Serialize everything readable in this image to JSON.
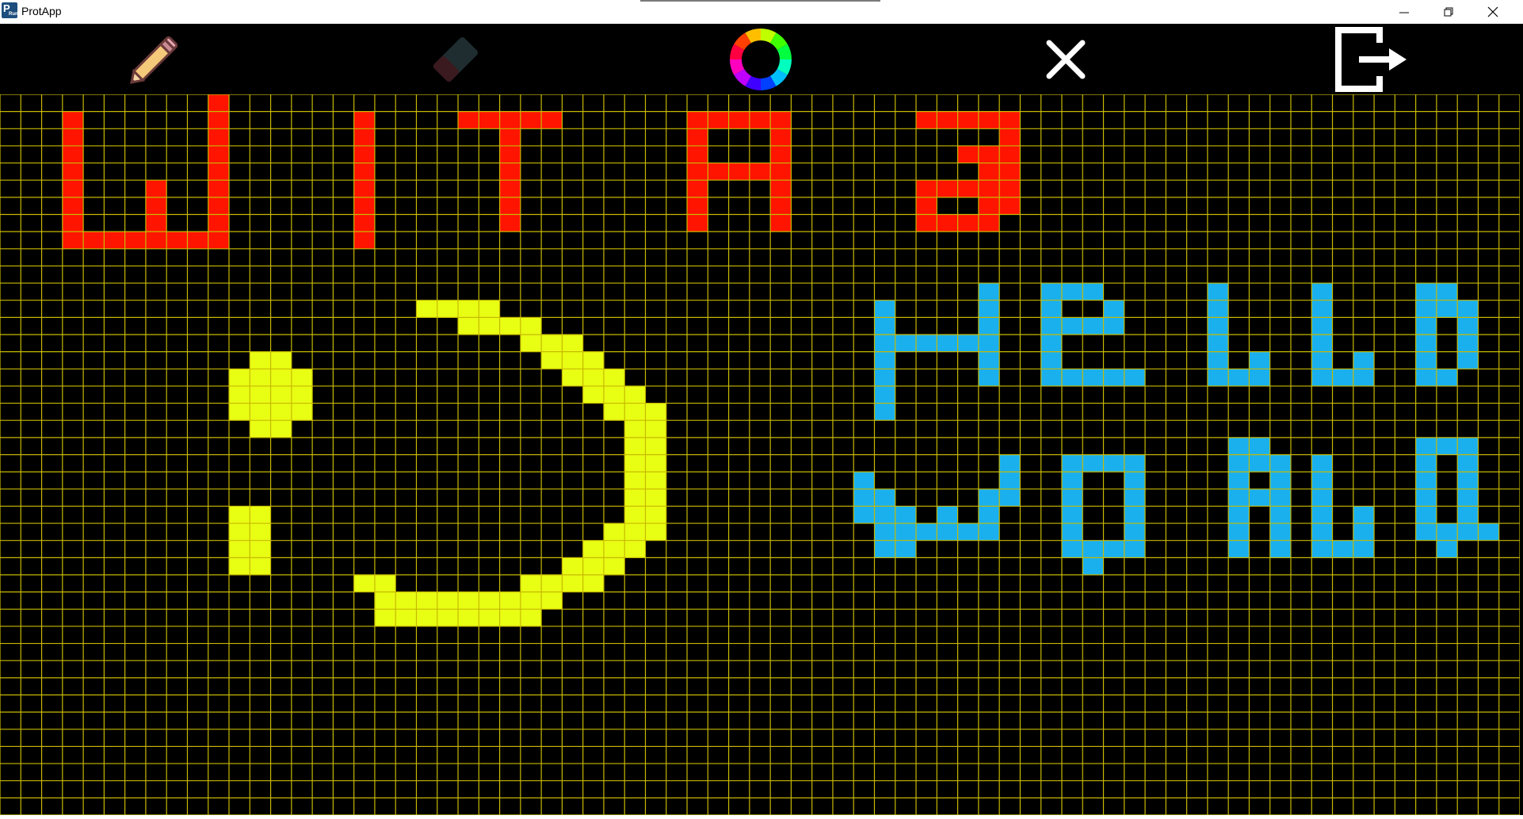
{
  "window": {
    "title": "ProtApp",
    "icon_label": "P",
    "icon_sublabel": "Run",
    "controls": [
      "minimize-icon",
      "restore-icon",
      "close-icon"
    ]
  },
  "toolbar": {
    "tools": [
      {
        "name": "pencil-tool-button",
        "icon": "pencil-icon"
      },
      {
        "name": "eraser-tool-button",
        "icon": "eraser-icon"
      },
      {
        "name": "color-picker-button",
        "icon": "color-wheel-icon"
      },
      {
        "name": "clear-canvas-button",
        "icon": "x-icon"
      },
      {
        "name": "exit-button",
        "icon": "exit-icon"
      }
    ]
  },
  "colors": {
    "grid_line": "#c7b900",
    "background": "#000000",
    "red": "#ff1400",
    "yellow": "#e8ff14",
    "blue": "#1ab0ee"
  },
  "grid": {
    "columns": 73,
    "rows": 42
  }
}
